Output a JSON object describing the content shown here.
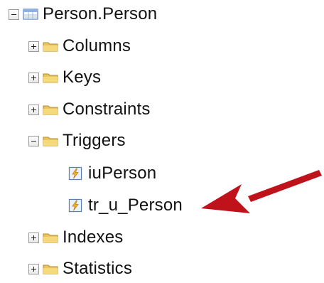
{
  "tree": {
    "table": {
      "label": "Person.Person",
      "icon": "table-icon",
      "expanded": true
    },
    "folders": [
      {
        "label": "Columns",
        "icon": "folder-icon",
        "expanded": false
      },
      {
        "label": "Keys",
        "icon": "folder-icon",
        "expanded": false
      },
      {
        "label": "Constraints",
        "icon": "folder-icon",
        "expanded": false
      },
      {
        "label": "Triggers",
        "icon": "folder-icon",
        "expanded": true
      },
      {
        "label": "Indexes",
        "icon": "folder-icon",
        "expanded": false
      },
      {
        "label": "Statistics",
        "icon": "folder-icon",
        "expanded": false
      }
    ],
    "triggers": [
      {
        "label": "iuPerson",
        "icon": "trigger-icon"
      },
      {
        "label": "tr_u_Person",
        "icon": "trigger-icon"
      }
    ]
  },
  "annotation": {
    "arrow_color": "#c0121b",
    "points_to": "tr_u_Person"
  }
}
